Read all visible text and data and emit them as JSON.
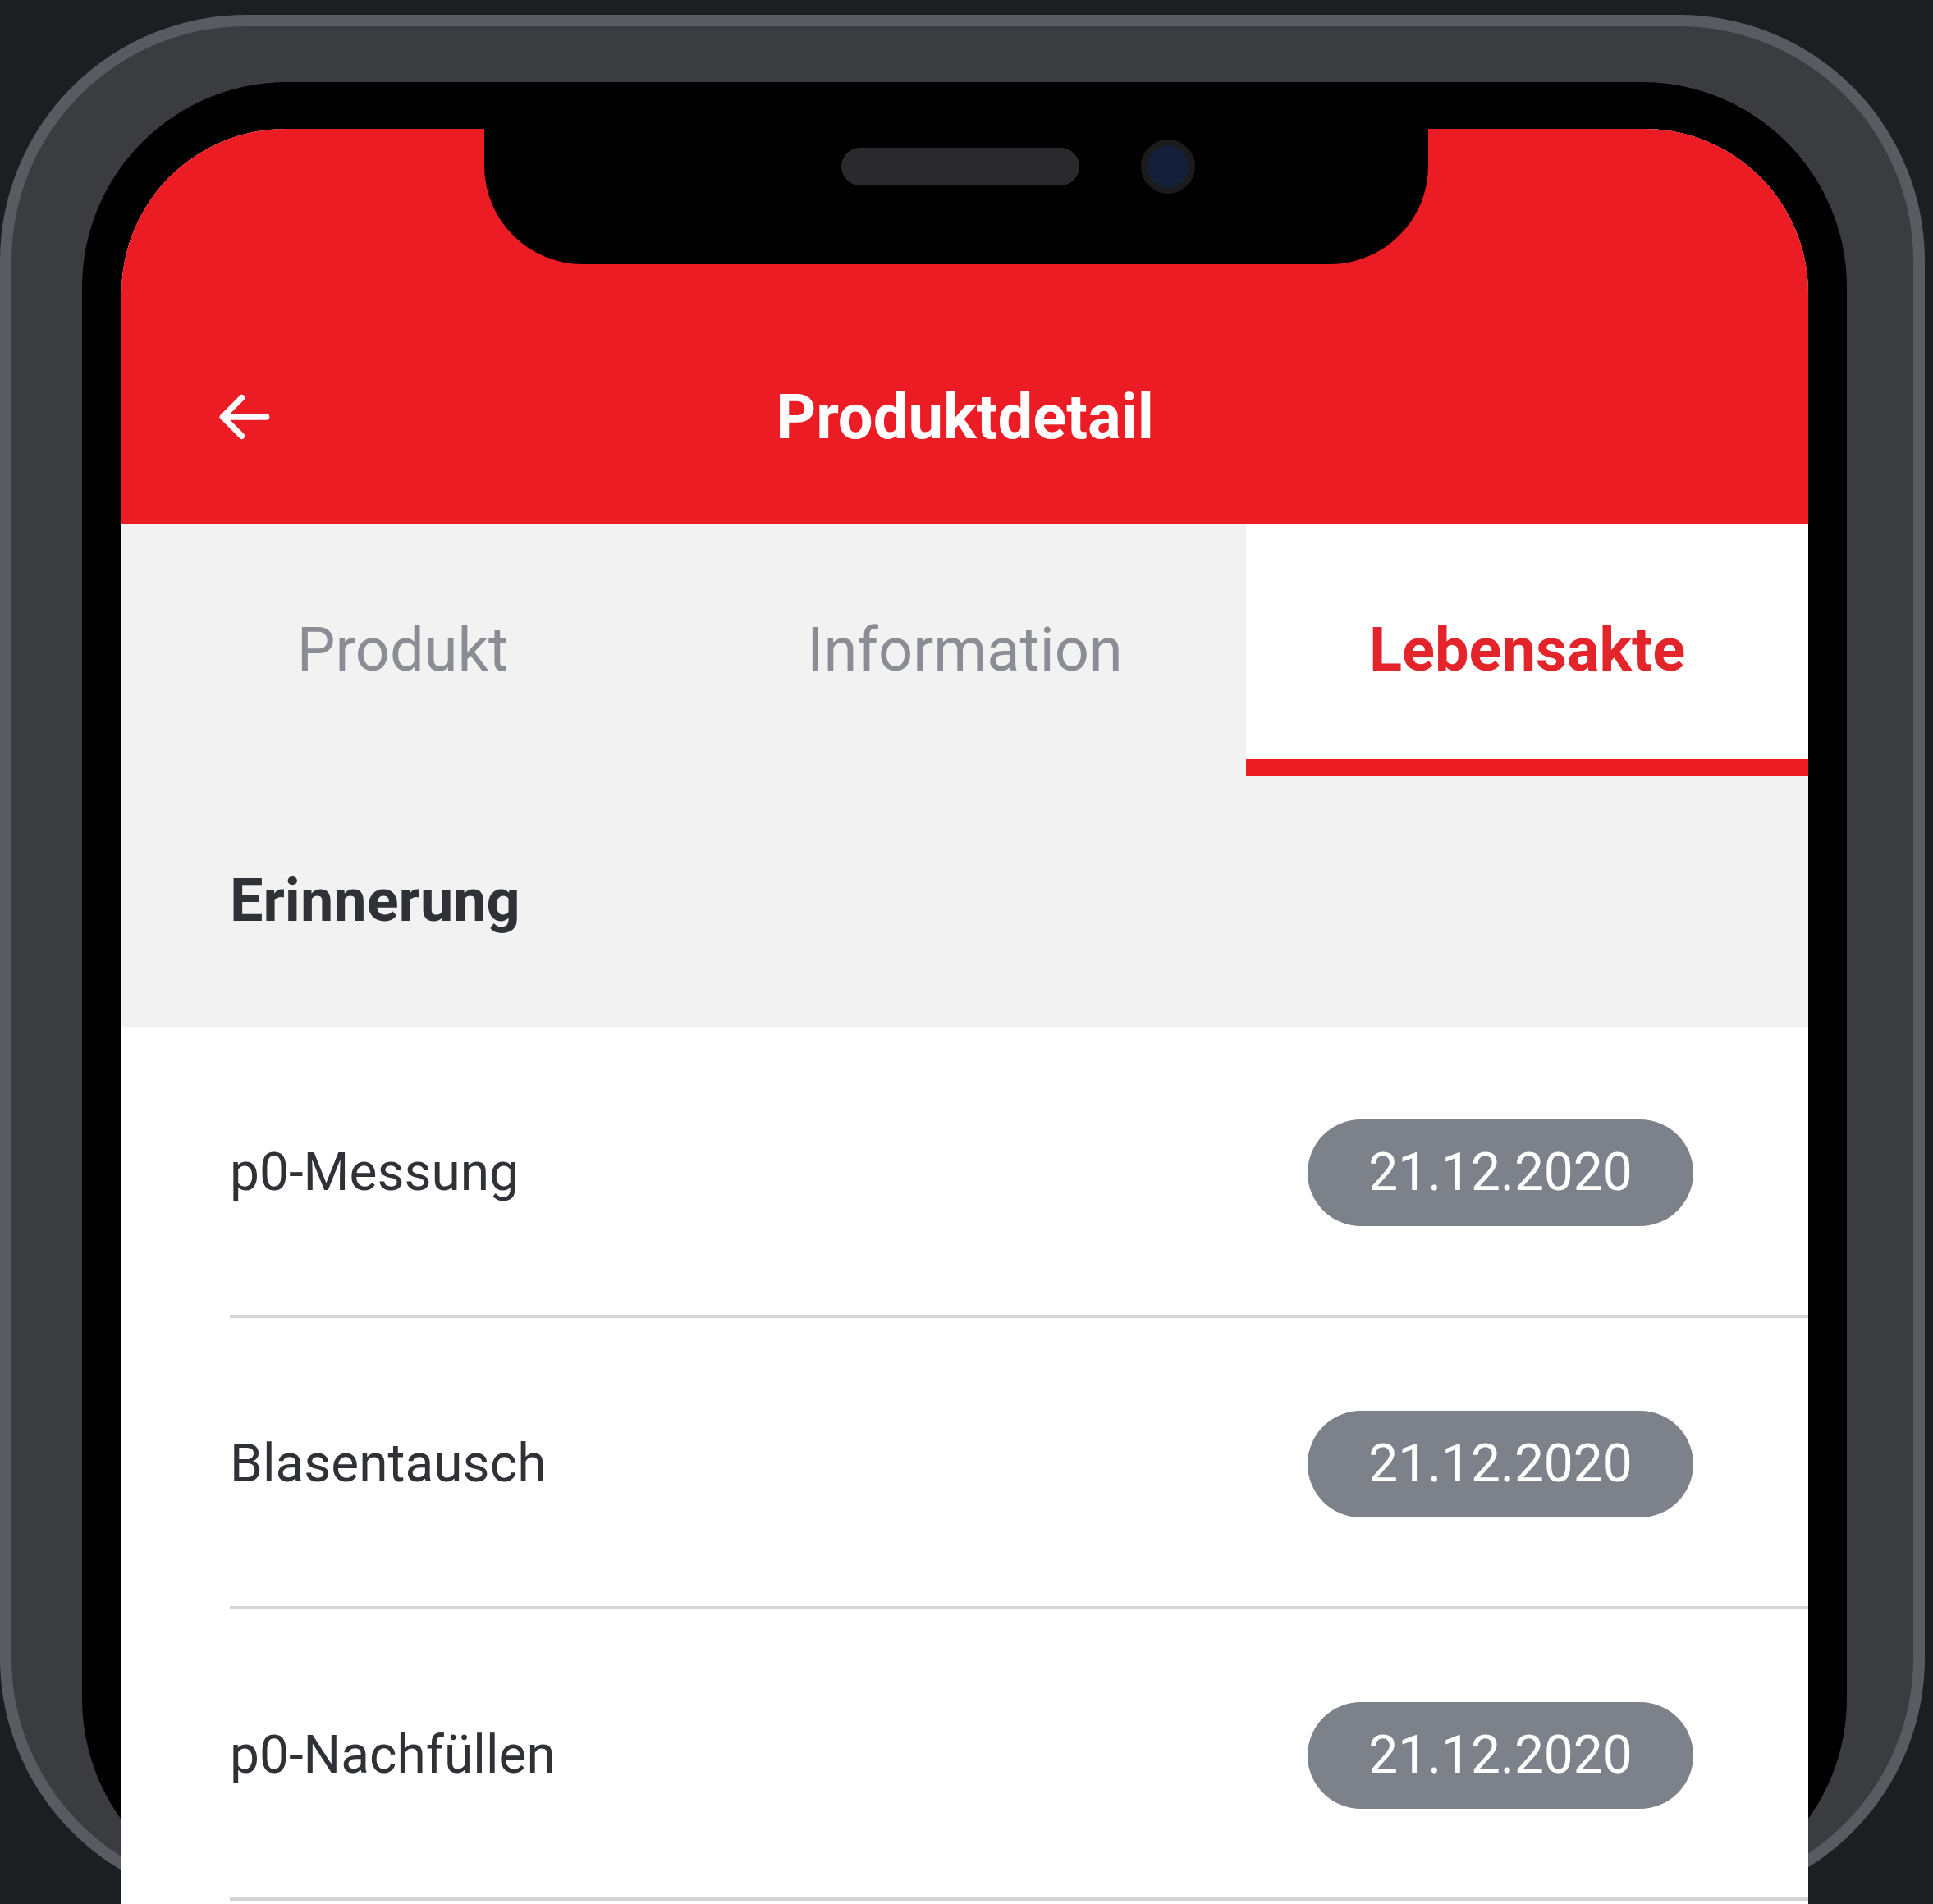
{
  "header": {
    "title": "Produktdetail"
  },
  "tabs": [
    {
      "label": "Produkt",
      "selected": false
    },
    {
      "label": "Information",
      "selected": false
    },
    {
      "label": "Lebensakte",
      "selected": true
    }
  ],
  "section": {
    "title": "Erinnerung"
  },
  "reminders": [
    {
      "label": "p0-Messung",
      "date": "21.12.2020"
    },
    {
      "label": "Blasentausch",
      "date": "21.12.2020"
    },
    {
      "label": "p0-Nachfüllen",
      "date": "21.12.2020"
    }
  ]
}
